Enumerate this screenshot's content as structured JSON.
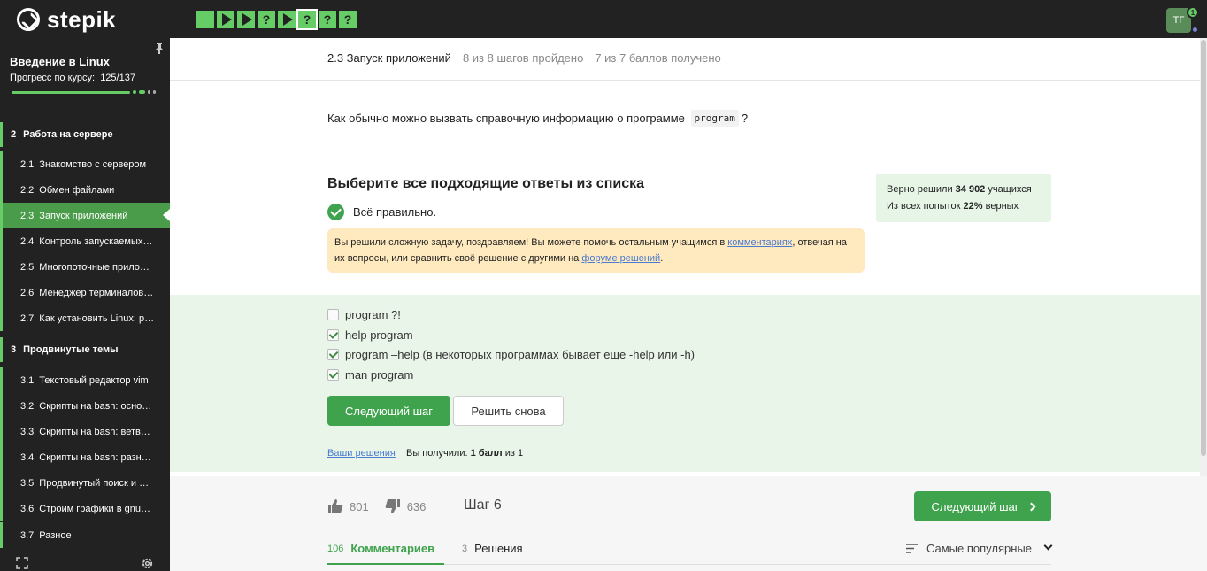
{
  "app": {
    "logo_text": "stepik",
    "avatar_initials": "ТГ",
    "notification_count": "1"
  },
  "colors": {
    "accent": "#3fa34d",
    "step_green": "#66cc66",
    "sidebar_bg": "#222222",
    "notice_bg": "#ffe9be",
    "stats_bg": "#e6f5e6",
    "panel_bg": "#e8f5e8"
  },
  "steps": [
    {
      "type": "text",
      "symbol": ""
    },
    {
      "type": "video",
      "symbol": ""
    },
    {
      "type": "video",
      "symbol": ""
    },
    {
      "type": "quiz",
      "symbol": "?"
    },
    {
      "type": "video",
      "symbol": ""
    },
    {
      "type": "quiz",
      "symbol": "?",
      "active": true
    },
    {
      "type": "quiz",
      "symbol": "?"
    },
    {
      "type": "quiz",
      "symbol": "?"
    }
  ],
  "sidebar": {
    "course_title": "Введение в Linux",
    "progress_label": "Прогресс по курсу:",
    "progress_value": "125/137",
    "progress": {
      "done": 125,
      "total": 137
    },
    "sections": [
      {
        "num": "2",
        "title": "Работа на сервере",
        "lessons": [
          {
            "num": "2.1",
            "title": "Знакомство с сервером"
          },
          {
            "num": "2.2",
            "title": "Обмен файлами"
          },
          {
            "num": "2.3",
            "title": "Запуск приложений",
            "active": true
          },
          {
            "num": "2.4",
            "title": "Контроль запускаемых…"
          },
          {
            "num": "2.5",
            "title": "Многопоточные прило…"
          },
          {
            "num": "2.6",
            "title": "Менеджер терминалов…"
          },
          {
            "num": "2.7",
            "title": "Как установить Linux: р…"
          }
        ]
      },
      {
        "num": "3",
        "title": "Продвинутые темы",
        "lessons": [
          {
            "num": "3.1",
            "title": "Текстовый редактор vim"
          },
          {
            "num": "3.2",
            "title": "Скрипты на bash: осно…"
          },
          {
            "num": "3.3",
            "title": "Скрипты на bash: ветв…"
          },
          {
            "num": "3.4",
            "title": "Скрипты на bash: разн…"
          },
          {
            "num": "3.5",
            "title": "Продвинутый поиск и …"
          },
          {
            "num": "3.6",
            "title": "Строим графики в gnu…"
          },
          {
            "num": "3.7",
            "title": "Разное"
          }
        ]
      }
    ]
  },
  "header": {
    "lesson": "2.3 Запуск приложений",
    "steps_passed": "8 из 8 шагов пройдено",
    "points": "7 из 7 баллов  получено"
  },
  "question": {
    "before": "Как обычно можно вызвать справочную информацию о программе",
    "code": "program",
    "after": "?"
  },
  "quiz": {
    "title": "Выберите все подходящие ответы из списка",
    "correct_text": "Всё правильно.",
    "notice_part1": "Вы решили сложную задачу, поздравляем! Вы можете помочь остальным учащимся в ",
    "notice_link1": "комментариях",
    "notice_part2": ", отвечая на их вопросы, или сравнить своё решение с другими на ",
    "notice_link2": "форуме решений",
    "notice_part3": ".",
    "options": [
      {
        "label": "program ?!",
        "checked": false
      },
      {
        "label": "help program",
        "checked": true
      },
      {
        "label": "program –help (в некоторых программах бывает еще -help или -h)",
        "checked": true
      },
      {
        "label": "man program",
        "checked": true
      }
    ],
    "next_button": "Следующий шаг",
    "retry_button": "Решить снова",
    "your_solutions": "Ваши решения",
    "score_prefix": "Вы получили:",
    "score_value": "1 балл",
    "score_suffix": "из 1"
  },
  "stats": {
    "solved_prefix": "Верно решили",
    "solved_value": "34 902",
    "solved_suffix": "учащихся",
    "attempts_prefix": "Из всех попыток",
    "attempts_value": "22%",
    "attempts_suffix": "верных"
  },
  "footer": {
    "likes": "801",
    "dislikes": "636",
    "step_label": "Шаг 6",
    "next_button": "Следующий шаг",
    "tabs": [
      {
        "count": "106",
        "label": "Комментариев"
      },
      {
        "count": "3",
        "label": "Решения"
      }
    ],
    "sort_label": "Самые популярные"
  }
}
